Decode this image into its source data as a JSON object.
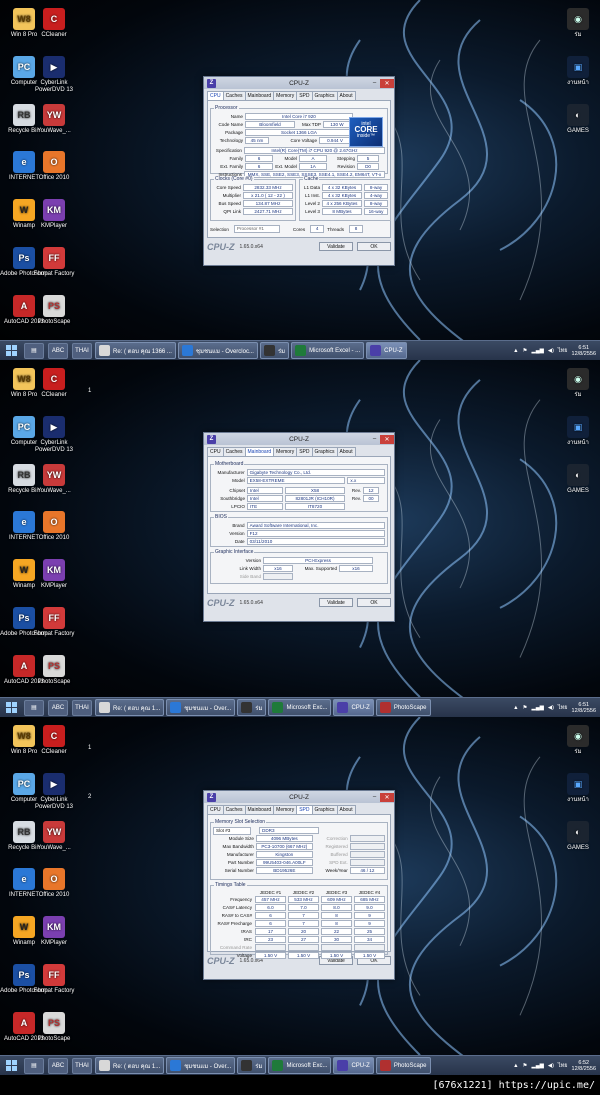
{
  "desktop_icons_left": [
    {
      "label": "Win 8 Pro",
      "glyph": "W8",
      "cls": "ic-win"
    },
    {
      "label": "Computer",
      "glyph": "PC",
      "cls": "ic-comp"
    },
    {
      "label": "Recycle Bin",
      "glyph": "RB",
      "cls": "ic-bin"
    },
    {
      "label": "INTERNET",
      "glyph": "e",
      "cls": "ic-ie"
    },
    {
      "label": "Winamp",
      "glyph": "W",
      "cls": "ic-wa"
    },
    {
      "label": "Adobe Photoshop",
      "glyph": "Ps",
      "cls": "ic-ps"
    },
    {
      "label": "AutoCAD 2013",
      "glyph": "A",
      "cls": "ic-ac"
    }
  ],
  "desktop_icons_col2": [
    {
      "label": "CCleaner",
      "glyph": "C",
      "cls": "ic-cc"
    },
    {
      "label": "CyberLink PowerDVD 13",
      "glyph": "▶",
      "cls": "ic-dvd"
    },
    {
      "label": "YouWave_...",
      "glyph": "YW",
      "cls": "ic-yt"
    },
    {
      "label": "Office 2010",
      "glyph": "O",
      "cls": "ic-off"
    },
    {
      "label": "KMPlayer",
      "glyph": "KM",
      "cls": "ic-km"
    },
    {
      "label": "Format Factory",
      "glyph": "FF",
      "cls": "ic-ff"
    },
    {
      "label": "PhotoScape",
      "glyph": "PS",
      "cls": "ic-psc"
    }
  ],
  "recycle_bin_label_variant": "Recycle Bin",
  "desktop_icons_right": [
    {
      "label": "ร่ม",
      "glyph": "◉",
      "cls": "ic-eye"
    },
    {
      "label": "งานหน้า",
      "glyph": "▣",
      "cls": "ic-blue"
    },
    {
      "label": "GAMES",
      "glyph": "◐",
      "cls": "ic-alien"
    },
    {
      "label": "งานหน้า",
      "glyph": "▣",
      "cls": "ic-blue"
    },
    {
      "label": "ร่ม",
      "glyph": "◉",
      "cls": "ic-eye"
    }
  ],
  "gadget_numbers": [
    "1",
    "1",
    "2"
  ],
  "cpuz_title": "CPU-Z",
  "tabs": [
    "CPU",
    "Caches",
    "Mainboard",
    "Memory",
    "SPD",
    "Graphics",
    "About"
  ],
  "footer": {
    "brand": "CPU-Z",
    "version": "1.65.0.x64",
    "validate": "Validate",
    "ok": "OK"
  },
  "cpu": {
    "group_processor": "Processor",
    "name_label": "Name",
    "name": "Intel Core i7 920",
    "codename_label": "Code Name",
    "codename": "Bloomfield",
    "tdp_label": "Max TDP",
    "tdp": "130 W",
    "package_label": "Package",
    "package": "Socket 1366 LGA",
    "tech_label": "Technology",
    "tech": "45 nm",
    "voltage_label": "Core Voltage",
    "voltage": "0.944 V",
    "spec_label": "Specification",
    "spec": "Intel(R) Core(TM) i7 CPU     920  @ 2.67GHz",
    "family_label": "Family",
    "family": "6",
    "model_label": "Model",
    "model": "A",
    "stepping_label": "Stepping",
    "stepping": "5",
    "extfamily_label": "Ext. Family",
    "extfamily": "6",
    "extmodel_label": "Ext. Model",
    "extmodel": "1A",
    "revision_label": "Revision",
    "revision": "D0",
    "instr_label": "Instructions",
    "instr": "MMX, SSE, SSE2, SSE3, SSSE3, SSE4.1, SSE4.2, EM64T, VT-x",
    "intel_logo": {
      "top": "intel",
      "mid": "CORE",
      "bottom": "inside™"
    },
    "clocks_title": "Clocks (Core #0)",
    "corespeed_label": "Core Speed",
    "corespeed": "2832.33 MHz",
    "multiplier_label": "Multiplier",
    "multiplier": "x 21.0 ( 12 - 22 )",
    "busspeed_label": "Bus Speed",
    "busspeed": "134.87 MHz",
    "qpi_label": "QPI Link",
    "qpi": "2427.71 MHz",
    "cache_title": "Cache",
    "l1d_label": "L1 Data",
    "l1d": "4 x 32 KBytes",
    "l1d_way": "8-way",
    "l1i_label": "L1 Inst.",
    "l1i": "4 x 32 KBytes",
    "l1i_way": "4-way",
    "l2_label": "Level 2",
    "l2": "4 x 256 KBytes",
    "l2_way": "8-way",
    "l3_label": "Level 3",
    "l3": "8 MBytes",
    "l3_way": "16-way",
    "selection_label": "Selection",
    "selection": "Processor #1",
    "cores_label": "Cores",
    "cores": "4",
    "threads_label": "Threads",
    "threads": "8"
  },
  "mainboard": {
    "group_mb": "Motherboard",
    "manufacturer_label": "Manufacturer",
    "manufacturer": "Gigabyte Technology Co., Ltd.",
    "model_label": "Model",
    "model": "EX58-EXTREME",
    "model_rev": "x.x",
    "chipset_label": "Chipset",
    "chipset_vendor": "Intel",
    "chipset": "X58",
    "rev_label": "Rev.",
    "chipset_rev": "12",
    "south_label": "Southbridge",
    "south_vendor": "Intel",
    "south": "82801JR (ICH10R)",
    "south_rev": "00",
    "lpcio_label": "LPCIO",
    "lpcio_vendor": "ITE",
    "lpcio": "IT8720",
    "group_bios": "BIOS",
    "brand_label": "Brand",
    "brand": "Award Software International, Inc.",
    "version_label": "Version",
    "version": "F12",
    "date_label": "Date",
    "date": "03/11/2010",
    "group_gi": "Graphic Interface",
    "gi_version_label": "Version",
    "gi_version": "PCI-Express",
    "linkwidth_label": "Link Width",
    "linkwidth": "x16",
    "maxsup_label": "Max. Supported",
    "maxsup": "x16",
    "sideband_label": "Side Band"
  },
  "spd": {
    "group_slot": "Memory Slot Selection",
    "slot": "Slot #3",
    "type": "DDR3",
    "modsize_label": "Module Size",
    "modsize": "4096 MBytes",
    "correction_label": "Correction",
    "maxbw_label": "Max Bandwidth",
    "maxbw": "PC3-10700 (667 MHz)",
    "registered_label": "Registered",
    "manuf_label": "Manufacturer",
    "manuf": "Kingston",
    "buffered_label": "Buffered",
    "partnum_label": "Part Number",
    "partnum": "99U5403-046.A00LF",
    "spdext_label": "SPD Ext.",
    "serial_label": "Serial Number",
    "serial": "BD19526E",
    "weekyear_label": "Week/Year",
    "weekyear": "46 / 12",
    "group_timing": "Timings Table",
    "timing_headers": [
      "JEDEC #1",
      "JEDEC #2",
      "JEDEC #3",
      "JEDEC #4"
    ],
    "timing_rows": [
      {
        "label": "Frequency",
        "vals": [
          "457 MHz",
          "533 MHz",
          "609 MHz",
          "685 MHz"
        ]
      },
      {
        "label": "CAS# Latency",
        "vals": [
          "6.0",
          "7.0",
          "8.0",
          "9.0"
        ]
      },
      {
        "label": "RAS# to CAS#",
        "vals": [
          "6",
          "7",
          "8",
          "9"
        ]
      },
      {
        "label": "RAS# Precharge",
        "vals": [
          "6",
          "7",
          "8",
          "9"
        ]
      },
      {
        "label": "tRAS",
        "vals": [
          "17",
          "20",
          "22",
          "25"
        ]
      },
      {
        "label": "tRC",
        "vals": [
          "23",
          "27",
          "30",
          "34"
        ]
      },
      {
        "label": "Command Rate",
        "vals": [
          "",
          "",
          "",
          ""
        ],
        "dim": true
      },
      {
        "label": "Voltage",
        "vals": [
          "1.50 V",
          "1.50 V",
          "1.50 V",
          "1.50 V"
        ]
      }
    ]
  },
  "taskbars": [
    {
      "pins": [
        "ABC",
        "THAI"
      ],
      "tasks": [
        {
          "label": "Re: ( ตอบ คุณ 1366 ...",
          "color": "#d8d8d8"
        },
        {
          "label": "ชุมชนแม - Overcloc...",
          "color": "#2b78d6"
        },
        {
          "label": "ร่ม",
          "color": "#333"
        },
        {
          "label": "Microsoft Excel - ...",
          "color": "#1f7a3a"
        },
        {
          "label": "CPU-Z",
          "color": "#4a3fa8",
          "active": true
        }
      ],
      "clock_time": "6:51",
      "clock_date": "12/8/2556",
      "lang": "ไทย"
    },
    {
      "pins": [
        "ABC",
        "THAI"
      ],
      "tasks": [
        {
          "label": "Re: ( ตอบ คุณ 1...",
          "color": "#d8d8d8"
        },
        {
          "label": "ชุมชนแม - Over...",
          "color": "#2b78d6"
        },
        {
          "label": "ร่ม",
          "color": "#333"
        },
        {
          "label": "Microsoft Exc...",
          "color": "#1f7a3a"
        },
        {
          "label": "CPU-Z",
          "color": "#4a3fa8",
          "active": true
        },
        {
          "label": "PhotoScape",
          "color": "#b03030"
        }
      ],
      "clock_time": "6:51",
      "clock_date": "12/8/2556",
      "lang": "ไทย"
    },
    {
      "pins": [
        "ABC",
        "THAI"
      ],
      "tasks": [
        {
          "label": "Re: ( ตอบ คุณ 1...",
          "color": "#d8d8d8"
        },
        {
          "label": "ชุมชนแม - Over...",
          "color": "#2b78d6"
        },
        {
          "label": "ร่ม",
          "color": "#333"
        },
        {
          "label": "Microsoft Exc...",
          "color": "#1f7a3a"
        },
        {
          "label": "CPU-Z",
          "color": "#4a3fa8",
          "active": true
        },
        {
          "label": "PhotoScape",
          "color": "#b03030"
        }
      ],
      "clock_time": "6:52",
      "clock_date": "12/8/2556",
      "lang": "ไทย"
    }
  ],
  "watermark": "[676x1221] https://upic.me/"
}
